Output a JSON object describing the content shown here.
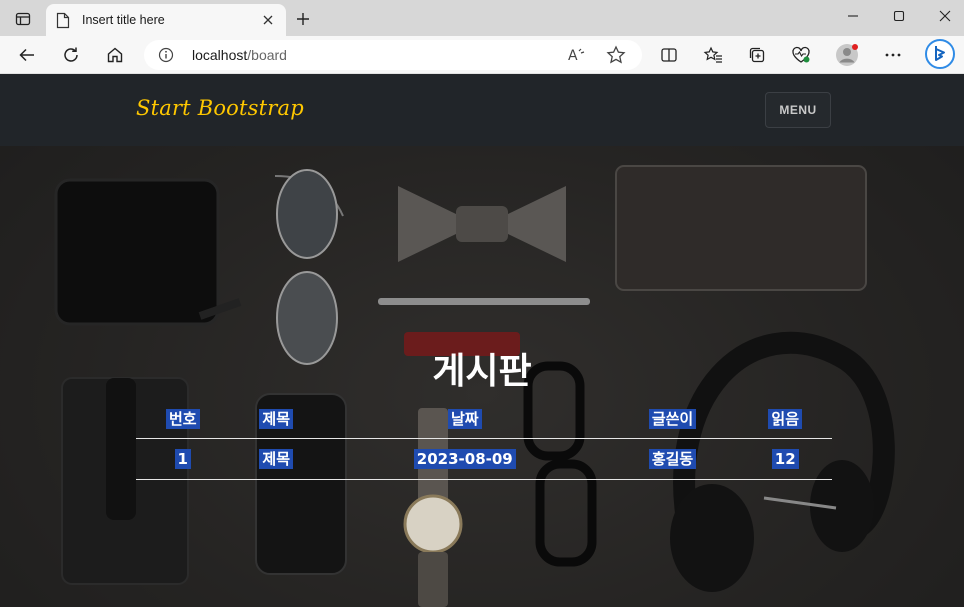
{
  "browser": {
    "tab_title": "Insert title here",
    "url_host": "localhost",
    "url_path": "/board",
    "read_aloud_glyph": "Ạͅ"
  },
  "page": {
    "brand": "Start Bootstrap",
    "menu_label": "MENU",
    "board_title": "게시판",
    "table": {
      "headers": [
        "번호",
        "제목",
        "날짜",
        "글쓴이",
        "읽음"
      ],
      "rows": [
        [
          "1",
          "제목",
          "2023-08-09",
          "홍길동",
          "12"
        ]
      ]
    }
  },
  "colors": {
    "brand": "#ffc800",
    "navbar": "#212529",
    "cell_highlight": "#1f4bb0"
  }
}
